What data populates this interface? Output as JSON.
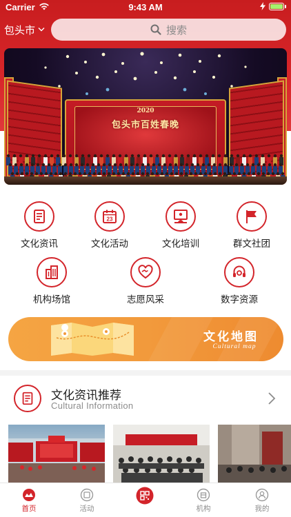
{
  "status_bar": {
    "carrier": "Carrier",
    "time": "9:43 AM"
  },
  "header": {
    "city": "包头市",
    "search_placeholder": "搜索"
  },
  "banner": {
    "stage_year": "2020",
    "stage_title": "包头市百姓春晚"
  },
  "categories": [
    {
      "label": "文化资讯",
      "icon": "document-icon"
    },
    {
      "label": "文化活动",
      "icon": "calendar-icon"
    },
    {
      "label": "文化培训",
      "icon": "training-board-icon"
    },
    {
      "label": "群文社团",
      "icon": "flag-icon"
    },
    {
      "label": "机构场馆",
      "icon": "building-icon"
    },
    {
      "label": "志愿风采",
      "icon": "heart-handshake-icon"
    },
    {
      "label": "数字资源",
      "icon": "headset-icon"
    }
  ],
  "calendar_day": "23",
  "map_banner": {
    "title": "文化地图",
    "subtitle": "Cultural map"
  },
  "section": {
    "title": "文化资讯推荐",
    "subtitle": "Cultural Information"
  },
  "tabs": [
    {
      "label": "首页",
      "icon": "home-icon",
      "active": true
    },
    {
      "label": "活动",
      "icon": "activity-icon",
      "active": false
    },
    {
      "label": "",
      "icon": "scan-icon",
      "active": false
    },
    {
      "label": "机构",
      "icon": "venue-icon",
      "active": false
    },
    {
      "label": "我的",
      "icon": "profile-icon",
      "active": false
    }
  ],
  "colors": {
    "brand_red": "#d3242a",
    "map_orange": "#f29a3c",
    "battery_fill": "#a6f26d"
  }
}
